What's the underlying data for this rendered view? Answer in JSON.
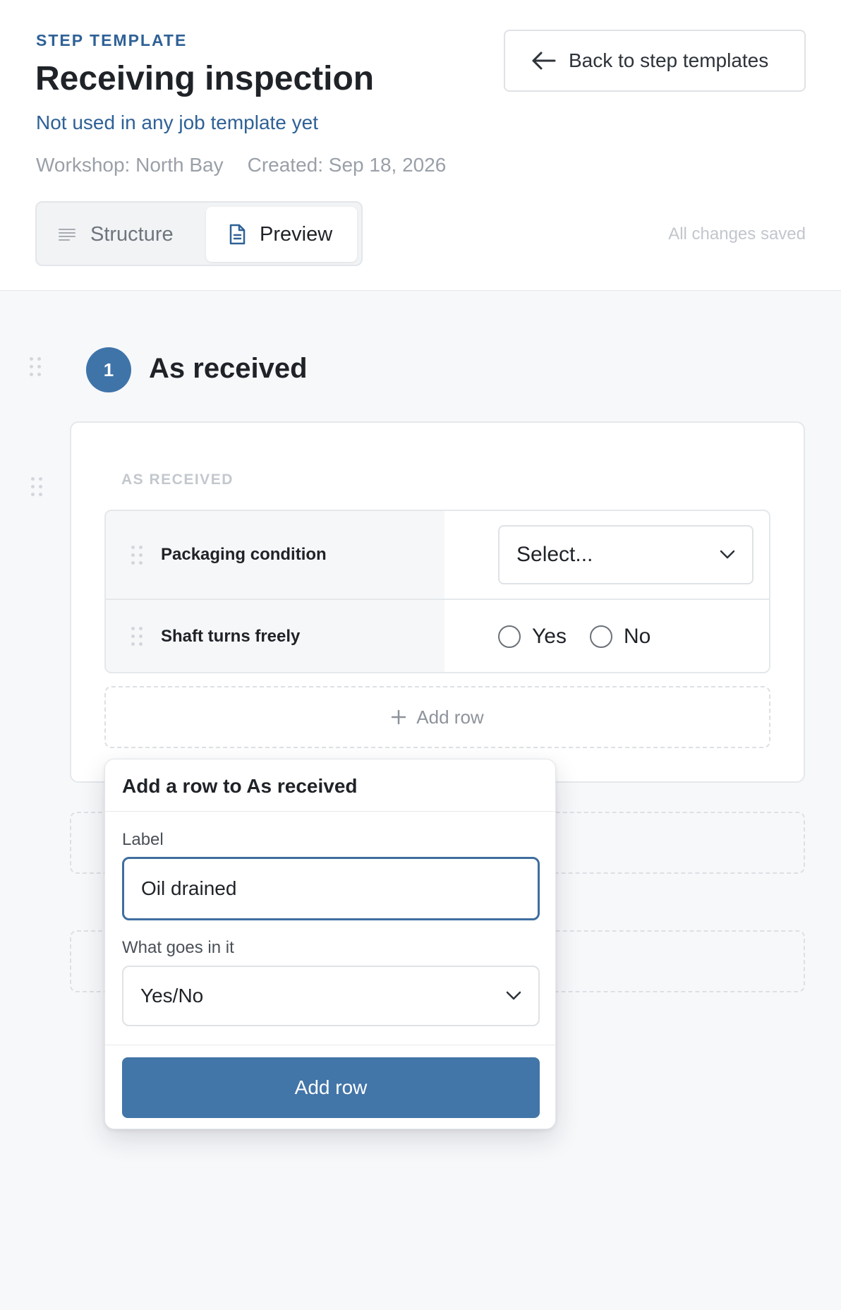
{
  "header": {
    "eyebrow": "STEP TEMPLATE",
    "title": "Receiving inspection",
    "usage": "Not used in any job template yet",
    "workshop": "Workshop: North Bay",
    "created": "Created: Sep 18, 2026",
    "back_label": "Back to step templates",
    "save_status": "All changes saved"
  },
  "tabs": [
    {
      "label": "Structure",
      "icon": "list-lines-icon",
      "active": false
    },
    {
      "label": "Preview",
      "icon": "document-icon",
      "active": true
    }
  ],
  "step": {
    "number": "1",
    "title": "As received",
    "section_label": "AS RECEIVED",
    "rows": [
      {
        "label": "Packaging condition",
        "control": "select",
        "value": "Select..."
      },
      {
        "label": "Shaft turns freely",
        "control": "yes-no",
        "options": [
          "Yes",
          "No"
        ]
      }
    ],
    "add_row_label": "Add row"
  },
  "popover": {
    "title": "Add a row to As received",
    "label_field_label": "Label",
    "label_value": "Oil drained",
    "type_field_label": "What goes in it",
    "type_value": "Yes/No",
    "submit_label": "Add row"
  },
  "colors": {
    "accent": "#4275a8",
    "eyebrow": "#2f6196",
    "muted": "#9aa0a8"
  }
}
